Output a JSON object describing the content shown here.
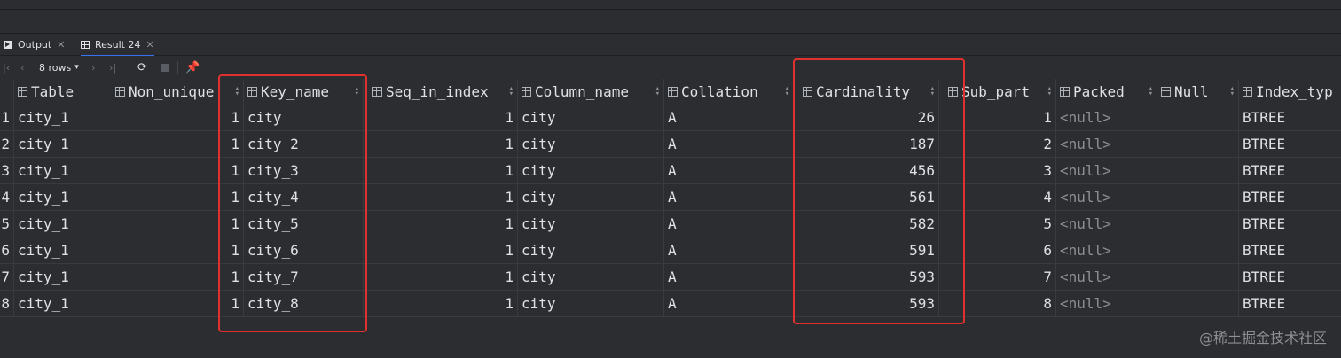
{
  "tabs": [
    {
      "label": "Output",
      "icon": "output-icon"
    },
    {
      "label": "Result 24",
      "icon": "table-grid-icon"
    }
  ],
  "toolbar": {
    "rows_label": "8 rows",
    "rows_dropdown_icon": "chevron-down-icon"
  },
  "table": {
    "columns": [
      "Table",
      "Non_unique",
      "Key_name",
      "Seq_in_index",
      "Column_name",
      "Collation",
      "Cardinality",
      "Sub_part",
      "Packed",
      "Null",
      "Index_typ"
    ],
    "rows": [
      {
        "n": "1",
        "Table": "city_1",
        "Non_unique": "1",
        "Key_name": "city",
        "Seq_in_index": "1",
        "Column_name": "city",
        "Collation": "A",
        "Cardinality": "26",
        "Sub_part": "1",
        "Packed": "<null>",
        "Null": "",
        "Index_type": "BTREE"
      },
      {
        "n": "2",
        "Table": "city_1",
        "Non_unique": "1",
        "Key_name": "city_2",
        "Seq_in_index": "1",
        "Column_name": "city",
        "Collation": "A",
        "Cardinality": "187",
        "Sub_part": "2",
        "Packed": "<null>",
        "Null": "",
        "Index_type": "BTREE"
      },
      {
        "n": "3",
        "Table": "city_1",
        "Non_unique": "1",
        "Key_name": "city_3",
        "Seq_in_index": "1",
        "Column_name": "city",
        "Collation": "A",
        "Cardinality": "456",
        "Sub_part": "3",
        "Packed": "<null>",
        "Null": "",
        "Index_type": "BTREE"
      },
      {
        "n": "4",
        "Table": "city_1",
        "Non_unique": "1",
        "Key_name": "city_4",
        "Seq_in_index": "1",
        "Column_name": "city",
        "Collation": "A",
        "Cardinality": "561",
        "Sub_part": "4",
        "Packed": "<null>",
        "Null": "",
        "Index_type": "BTREE"
      },
      {
        "n": "5",
        "Table": "city_1",
        "Non_unique": "1",
        "Key_name": "city_5",
        "Seq_in_index": "1",
        "Column_name": "city",
        "Collation": "A",
        "Cardinality": "582",
        "Sub_part": "5",
        "Packed": "<null>",
        "Null": "",
        "Index_type": "BTREE"
      },
      {
        "n": "6",
        "Table": "city_1",
        "Non_unique": "1",
        "Key_name": "city_6",
        "Seq_in_index": "1",
        "Column_name": "city",
        "Collation": "A",
        "Cardinality": "591",
        "Sub_part": "6",
        "Packed": "<null>",
        "Null": "",
        "Index_type": "BTREE"
      },
      {
        "n": "7",
        "Table": "city_1",
        "Non_unique": "1",
        "Key_name": "city_7",
        "Seq_in_index": "1",
        "Column_name": "city",
        "Collation": "A",
        "Cardinality": "593",
        "Sub_part": "7",
        "Packed": "<null>",
        "Null": "",
        "Index_type": "BTREE"
      },
      {
        "n": "8",
        "Table": "city_1",
        "Non_unique": "1",
        "Key_name": "city_8",
        "Seq_in_index": "1",
        "Column_name": "city",
        "Collation": "A",
        "Cardinality": "593",
        "Sub_part": "8",
        "Packed": "<null>",
        "Null": "",
        "Index_type": "BTREE"
      }
    ]
  },
  "annotations": {
    "highlight_color": "#e0312e"
  },
  "watermark": "@稀土掘金技术社区"
}
